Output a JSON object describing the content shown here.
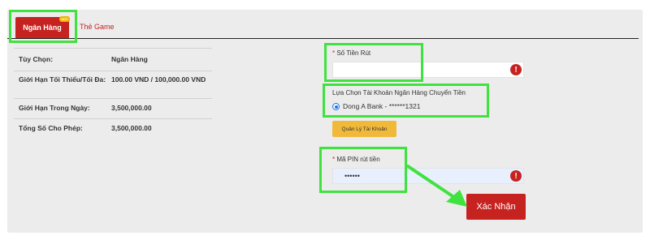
{
  "tabs": {
    "bank_label": "Ngân Hàng",
    "hot_badge": "HOT",
    "game_label": "Thẻ Game"
  },
  "info": {
    "rows": [
      {
        "key": "Tùy Chọn:",
        "value": "Ngân Hàng"
      },
      {
        "key": "Giới Hạn Tối Thiểu/Tối Đa:",
        "value": "100.00 VND / 100,000.00 VND"
      },
      {
        "key": "Giới Hạn Trong Ngày:",
        "value": "3,500,000.00"
      },
      {
        "key": "Tổng Số Cho Phép:",
        "value": "3,500,000.00"
      }
    ]
  },
  "form": {
    "amount_label": "Số Tiền Rút",
    "amount_value": "",
    "account_select_label": "Lựa Chọn Tài Khoản Ngân Hàng Chuyển Tiền",
    "account_option": "Dong A Bank - ******1321",
    "manage_button": "Quản Lý Tài Khoản",
    "pin_label": "Mã PIN rút tiền",
    "pin_value": "••••••",
    "submit_button": "Xác Nhận",
    "error_glyph": "!"
  },
  "colors": {
    "accent_red": "#c62320",
    "highlight_green": "#3fe23f",
    "button_yellow": "#f0b93a"
  }
}
